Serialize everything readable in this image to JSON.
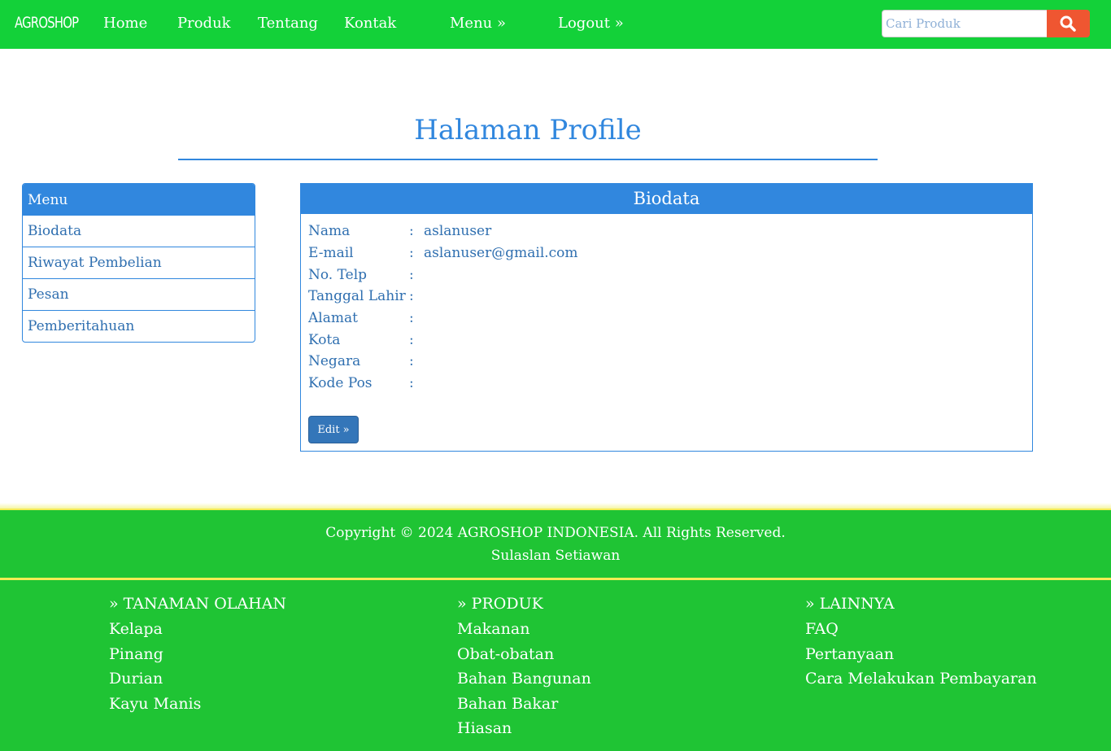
{
  "navbar": {
    "brand": "AGROSHOP",
    "links": [
      "Home",
      "Produk",
      "Tentang",
      "Kontak"
    ],
    "menu": "Menu »",
    "logout": "Logout »",
    "search_placeholder": "Cari Produk",
    "search_icon": "search-icon"
  },
  "page": {
    "title": "Halaman Profile"
  },
  "side_menu": {
    "header": "Menu",
    "items": [
      "Biodata",
      "Riwayat Pembelian",
      "Pesan",
      "Pemberitahuan"
    ]
  },
  "biodata": {
    "header": "Biodata",
    "fields": [
      {
        "label": "Nama",
        "colon": ":",
        "value": "aslanuser"
      },
      {
        "label": "E-mail",
        "colon": ":",
        "value": "aslanuser@gmail.com"
      },
      {
        "label": "No. Telp",
        "colon": ":",
        "value": ""
      },
      {
        "label": "Tanggal Lahir",
        "colon": ":",
        "value": ""
      },
      {
        "label": "Alamat",
        "colon": ":",
        "value": ""
      },
      {
        "label": "Kota",
        "colon": ":",
        "value": ""
      },
      {
        "label": "Negara",
        "colon": ":",
        "value": ""
      },
      {
        "label": "Kode Pos",
        "colon": ":",
        "value": ""
      }
    ],
    "edit_label": "Edit »"
  },
  "footer": {
    "copyright": "Copyright © 2024 AGROSHOP INDONESIA. All Rights Reserved.",
    "author": "Sulaslan Setiawan",
    "columns": [
      {
        "title": "» TANAMAN OLAHAN",
        "items": [
          "Kelapa",
          "Pinang",
          "Durian",
          "Kayu Manis"
        ]
      },
      {
        "title": "» PRODUK",
        "items": [
          "Makanan",
          "Obat-obatan",
          "Bahan Bangunan",
          "Bahan Bakar",
          "Hiasan"
        ]
      },
      {
        "title": "» LAINNYA",
        "items": [
          "FAQ",
          "Pertanyaan",
          "Cara Melakukan Pembayaran"
        ]
      }
    ]
  },
  "colors": {
    "navbar_green": "#13d139",
    "footer_green": "#1fc434",
    "accent_blue": "#3187de",
    "search_button": "#ef5631",
    "footer_border_yellow": "#f3ec55"
  }
}
